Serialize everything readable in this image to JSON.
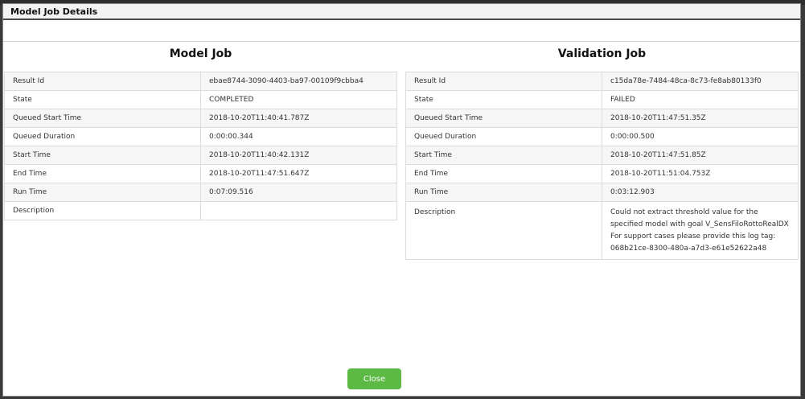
{
  "dialog": {
    "title": "Model Job Details",
    "close_label": "Close"
  },
  "model_job": {
    "heading": "Model Job",
    "rows": [
      {
        "key": "Result Id",
        "value": "ebae8744-3090-4403-ba97-00109f9cbba4"
      },
      {
        "key": "State",
        "value": "COMPLETED"
      },
      {
        "key": "Queued Start Time",
        "value": "2018-10-20T11:40:41.787Z"
      },
      {
        "key": "Queued Duration",
        "value": "0:00:00.344"
      },
      {
        "key": "Start Time",
        "value": "2018-10-20T11:40:42.131Z"
      },
      {
        "key": "End Time",
        "value": "2018-10-20T11:47:51.647Z"
      },
      {
        "key": "Run Time",
        "value": "0:07:09.516"
      },
      {
        "key": "Description",
        "value": ""
      }
    ]
  },
  "validation_job": {
    "heading": "Validation Job",
    "rows": [
      {
        "key": "Result Id",
        "value": "c15da78e-7484-48ca-8c73-fe8ab80133f0"
      },
      {
        "key": "State",
        "value": "FAILED"
      },
      {
        "key": "Queued Start Time",
        "value": "2018-10-20T11:47:51.35Z"
      },
      {
        "key": "Queued Duration",
        "value": "0:00:00.500"
      },
      {
        "key": "Start Time",
        "value": "2018-10-20T11:47:51.85Z"
      },
      {
        "key": "End Time",
        "value": "2018-10-20T11:51:04.753Z"
      },
      {
        "key": "Run Time",
        "value": "0:03:12.903"
      },
      {
        "key": "Description",
        "value": "Could not extract threshold value for the specified model with goal V_SensFiloRottoRealDX For support cases please provide this log tag: 068b21ce-8300-480a-a7d3-e61e52622a48"
      }
    ]
  }
}
